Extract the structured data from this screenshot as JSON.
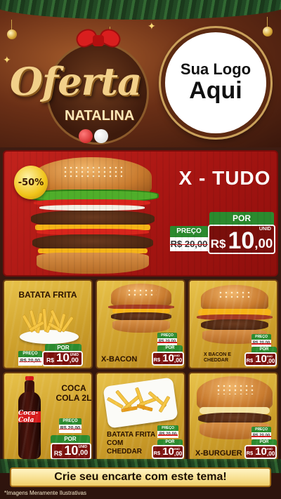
{
  "header": {
    "oferta_title": "Oferta",
    "natalina_title": "NATALINA",
    "logo_line1": "Sua Logo",
    "logo_line2": "Aqui"
  },
  "featured": {
    "discount": "-50%",
    "name": "X - TUDO",
    "preco_label": "PREÇO",
    "old_price": "R$ 20,00",
    "por_label": "POR",
    "currency": "R$",
    "price_int": "10",
    "price_cents": ",00",
    "unit": "UNID"
  },
  "products": [
    {
      "name": "BATATA FRITA",
      "preco_label": "PREÇO",
      "old_price": "R$ 20,00",
      "por_label": "POR",
      "currency": "R$",
      "price_int": "10",
      "price_cents": ",00",
      "unit": "UNID"
    },
    {
      "name": "X-BACON",
      "preco_label": "PREÇO",
      "old_price": "R$ 20,00",
      "por_label": "POR",
      "currency": "R$",
      "price_int": "10",
      "price_cents": ",00",
      "unit": "UNID"
    },
    {
      "name": "X BACON E CHEDDAR",
      "preco_label": "PREÇO",
      "old_price": "R$ 20,00",
      "por_label": "POR",
      "currency": "R$",
      "price_int": "10",
      "price_cents": ",00",
      "unit": "UNID"
    },
    {
      "name": "COCA COLA 2L",
      "bottle_label": "Coca-Cola",
      "preco_label": "PREÇO",
      "old_price": "R$ 20,00",
      "por_label": "POR",
      "currency": "R$",
      "price_int": "10",
      "price_cents": ",00",
      "unit": "UNID"
    },
    {
      "name": "BATATA FRITA COM CHEDDAR",
      "preco_label": "PREÇO",
      "old_price": "R$ 20,00",
      "por_label": "POR",
      "currency": "R$",
      "price_int": "10",
      "price_cents": ",00",
      "unit": "UNID"
    },
    {
      "name": "X-BURGUER",
      "preco_label": "PREÇO",
      "old_price": "R$ 20,00",
      "por_label": "POR",
      "currency": "R$",
      "price_int": "10",
      "price_cents": ",00",
      "unit": "UNID"
    }
  ],
  "footer": {
    "cta": "Crie seu encarte com este tema!",
    "note": "*Imagens Meramente Ilustrativas"
  },
  "colors": {
    "featured_bg": "#c3231d",
    "card_bg": "#e8c24a",
    "tag_green": "#2b8a2e",
    "tag_red": "#7a0f0b"
  }
}
